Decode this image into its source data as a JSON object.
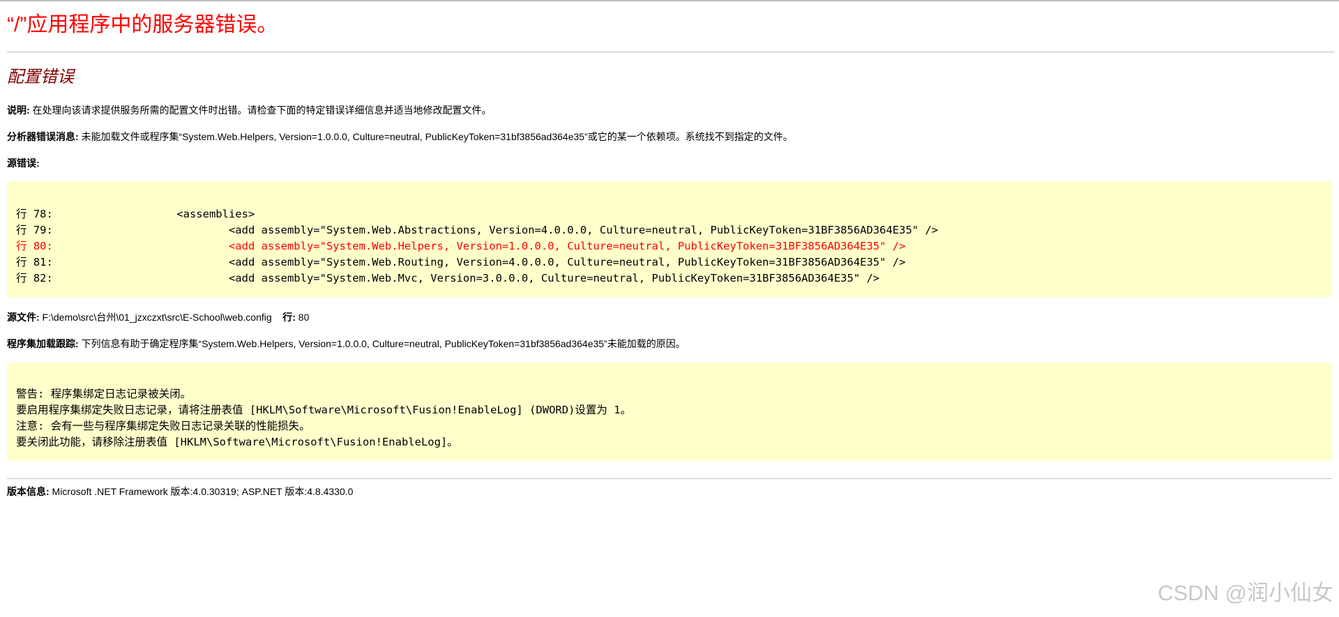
{
  "page": {
    "title": "“/”应用程序中的服务器错误。",
    "subtitle": "配置错误",
    "description_label": "说明:",
    "description_text": " 在处理向该请求提供服务所需的配置文件时出错。请检查下面的特定错误详细信息并适当地修改配置文件。",
    "parser_label": "分析器错误消息:",
    "parser_text": " 未能加载文件或程序集“System.Web.Helpers, Version=1.0.0.0, Culture=neutral, PublicKeyToken=31bf3856ad364e35”或它的某一个依赖项。系统找不到指定的文件。",
    "source_error_label": "源错误:",
    "source_lines": [
      {
        "label": "行 78:",
        "code": "                <assemblies>",
        "error": false
      },
      {
        "label": "行 79:",
        "code": "                        <add assembly=\"System.Web.Abstractions, Version=4.0.0.0, Culture=neutral, PublicKeyToken=31BF3856AD364E35\" />",
        "error": false
      },
      {
        "label": "行 80:",
        "code": "                        <add assembly=\"System.Web.Helpers, Version=1.0.0.0, Culture=neutral, PublicKeyToken=31BF3856AD364E35\" />",
        "error": true
      },
      {
        "label": "行 81:",
        "code": "                        <add assembly=\"System.Web.Routing, Version=4.0.0.0, Culture=neutral, PublicKeyToken=31BF3856AD364E35\" />",
        "error": false
      },
      {
        "label": "行 82:",
        "code": "                        <add assembly=\"System.Web.Mvc, Version=3.0.0.0, Culture=neutral, PublicKeyToken=31BF3856AD364E35\" />",
        "error": false
      }
    ],
    "source_file_label": "源文件:",
    "source_file_path": " F:\\demo\\src\\台州\\01_jzxczxt\\src\\E-School\\web.config",
    "line_label": "行:",
    "line_value": " 80",
    "assembly_trace_label": "程序集加载跟踪:",
    "assembly_trace_text": " 下列信息有助于确定程序集“System.Web.Helpers, Version=1.0.0.0, Culture=neutral, PublicKeyToken=31bf3856ad364e35”未能加载的原因。",
    "trace_lines": [
      "警告: 程序集绑定日志记录被关闭。",
      "要启用程序集绑定失败日志记录，请将注册表值 [HKLM\\Software\\Microsoft\\Fusion!EnableLog] (DWORD)设置为 1。",
      "注意: 会有一些与程序集绑定失败日志记录关联的性能损失。",
      "要关闭此功能，请移除注册表值 [HKLM\\Software\\Microsoft\\Fusion!EnableLog]。"
    ],
    "version_label": "版本信息:",
    "version_text": " Microsoft .NET Framework 版本:4.0.30319; ASP.NET 版本:4.8.4330.0"
  },
  "watermark": "CSDN @润小仙女",
  "colors": {
    "title": "#ff0000",
    "subtitle": "#800000",
    "code_background": "#ffffcc",
    "error_line": "#ff0000"
  }
}
